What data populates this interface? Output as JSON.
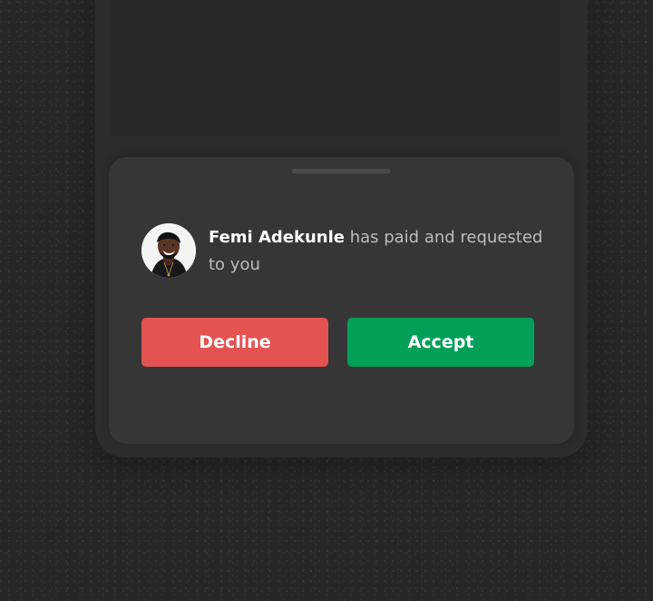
{
  "notification": {
    "sender_name": "Femi Adekunle",
    "message": " has paid and requested to you",
    "avatar_icon": "person-avatar"
  },
  "actions": {
    "decline_label": "Decline",
    "accept_label": "Accept"
  },
  "colors": {
    "background": "#262626",
    "phone_frame": "#2c2c2c",
    "sheet": "#363636",
    "decline": "#e55252",
    "accept": "#019f58",
    "primary_text": "#ffffff",
    "secondary_text": "#bdbdbd"
  }
}
